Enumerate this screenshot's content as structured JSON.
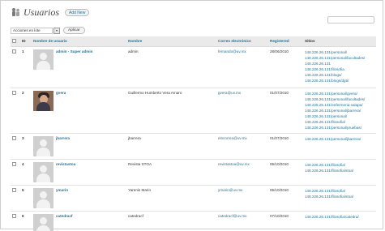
{
  "page": {
    "title": "Usuarios",
    "add_new_label": "Add New",
    "bulk_action_selected": "Acciones en lote",
    "apply_label": "Aplicar"
  },
  "table": {
    "headers": {
      "id": "ID",
      "username": "Nombre de usuario",
      "name": "Nombre",
      "email": "Correo electrónico",
      "registered": "Registered",
      "sites": "Sitios"
    },
    "rows": [
      {
        "id": "1",
        "username": "admin - Super admin",
        "name": "admin",
        "email": "fernando@uv.mx",
        "registered": "28/06/2010",
        "avatar": "default",
        "sites": [
          "148.226.26.131/personal/",
          "148.226.26.131/personal/facultades/",
          "148.226.26.131",
          "148.226.26.131/filosofia",
          "148.226.26.131/blogs/",
          "148.226.26.131/blogs/dgti/"
        ]
      },
      {
        "id": "2",
        "username": "gvera",
        "name": "Guillermo Humberto Vera Amaro",
        "email": "gvera@uv.mx",
        "registered": "01/07/2010",
        "avatar": "photo",
        "sites": [
          "148.226.26.131/personal/gvera/",
          "148.226.26.131/personal/facultades/",
          "148.226.26.131/enfermeria-xalapa/",
          "148.226.26.131/personal/jbarrera/",
          "148.226.26.131/personal/",
          "148.226.26.131/filosofia/",
          "148.226.26.131/personal/pruebas/"
        ]
      },
      {
        "id": "3",
        "username": "jbarrera",
        "name": "jbarrera",
        "email": "elncorreo@uv.mx",
        "registered": "01/07/2010",
        "avatar": "default",
        "sites": [
          "148.226.26.131/personal/jbarrera/"
        ]
      },
      {
        "id": "4",
        "username": "revistastoa",
        "name": "Revista STOA",
        "email": "revistastoa@uv.mx",
        "registered": "05/10/2010",
        "avatar": "default",
        "sites": [
          "148.226.26.131/filosofia/",
          "148.226.26.131/filosofia/stoa/"
        ]
      },
      {
        "id": "5",
        "username": "ymarin",
        "name": "Yarenis Marin",
        "email": "ymarin@uv.mx",
        "registered": "05/10/2010",
        "avatar": "default",
        "sites": [
          "148.226.26.131/filosofia/",
          "148.226.26.131/filosofia/stoa/"
        ]
      },
      {
        "id": "6",
        "username": "catedracf",
        "name": "catedracf",
        "email": "catedracf@uv.mx",
        "registered": "07/10/2010",
        "avatar": "default",
        "sites": [
          "148.226.26.131/filosofia/catedra/"
        ]
      }
    ]
  },
  "colors": {
    "link": "#21759b",
    "header_bg": "#eaeaea",
    "avatar_default": "#cfcfcf"
  }
}
